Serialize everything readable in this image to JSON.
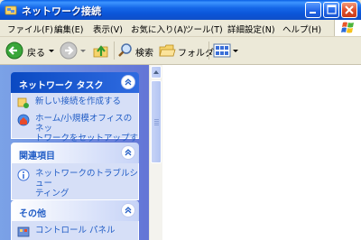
{
  "window": {
    "title": "ネットワーク接続",
    "icon": "network-folder-icon"
  },
  "menu": {
    "items": [
      "ファイル(F)",
      "編集(E)",
      "表示(V)",
      "お気に入り(A)",
      "ツール(T)",
      "詳細設定(N)",
      "ヘルプ(H)"
    ]
  },
  "toolbar": {
    "back_label": "戻る",
    "search_label": "検索",
    "folders_label": "フォルダ"
  },
  "taskpane": {
    "network_tasks": {
      "header": "ネットワーク タスク",
      "items": [
        {
          "label": "新しい接続を作成する",
          "icon": "new-connection-icon"
        },
        {
          "label": "ホーム/小規模オフィスのネットワークをセットアップする",
          "label_line1": "ホーム/小規模オフィスのネッ",
          "label_line2": "トワークをセットアップする",
          "icon": "home-network-setup-icon"
        }
      ]
    },
    "see_also": {
      "header": "関連項目",
      "items": [
        {
          "label": "ネットワークのトラブルシューティング",
          "label_line1": "ネットワークのトラブルシュー",
          "label_line2": "ティング",
          "icon": "info-icon"
        }
      ]
    },
    "other_places": {
      "header": "その他",
      "items": [
        {
          "label": "コントロール パネル",
          "icon": "control-panel-icon"
        }
      ]
    }
  },
  "colors": {
    "title_bar": "#0B55D8",
    "task_pane": "#6E8DDE",
    "link_text": "#215DC6",
    "group_body": "#D6DFF7"
  }
}
